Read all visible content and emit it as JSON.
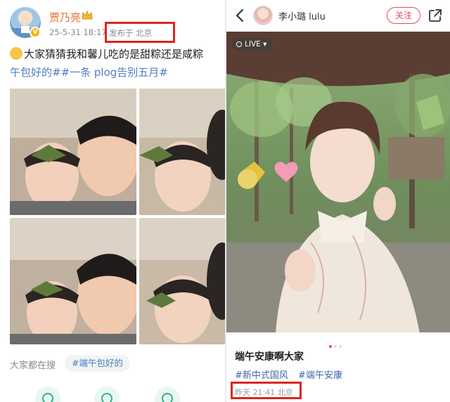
{
  "left_post": {
    "username": "贾乃亮",
    "time": "25-5-31 18:17",
    "location": "发布于 北京",
    "text_line1": "大家猜猜我和馨儿吃的是甜粽还是咸粽",
    "text_line2": "午包好的##一条 plog告别五月#",
    "search_label": "大家都在搜",
    "search_tag": "#端午包好的",
    "icons": [
      "user-icon",
      "crown-icon",
      "emoji-icon",
      "comment-icon",
      "repost-icon",
      "like-icon"
    ],
    "colors": {
      "username": "#e8712c",
      "hashtag": "#4e7fbf",
      "highlight_box": "#d9271f"
    }
  },
  "right_post": {
    "username": "李小璐 lulu",
    "follow_label": "关注",
    "live_label": "LIVE",
    "title": "端午安康啊大家",
    "tags": [
      "#新中式国风",
      "#端午安康"
    ],
    "time_location": "昨天 21:41 北京",
    "pager_active": 1,
    "pager_total": 3,
    "icons": [
      "back-icon",
      "share-icon",
      "live-icon"
    ],
    "colors": {
      "follow": "#e8475d",
      "tag": "#3a6aa8"
    }
  }
}
